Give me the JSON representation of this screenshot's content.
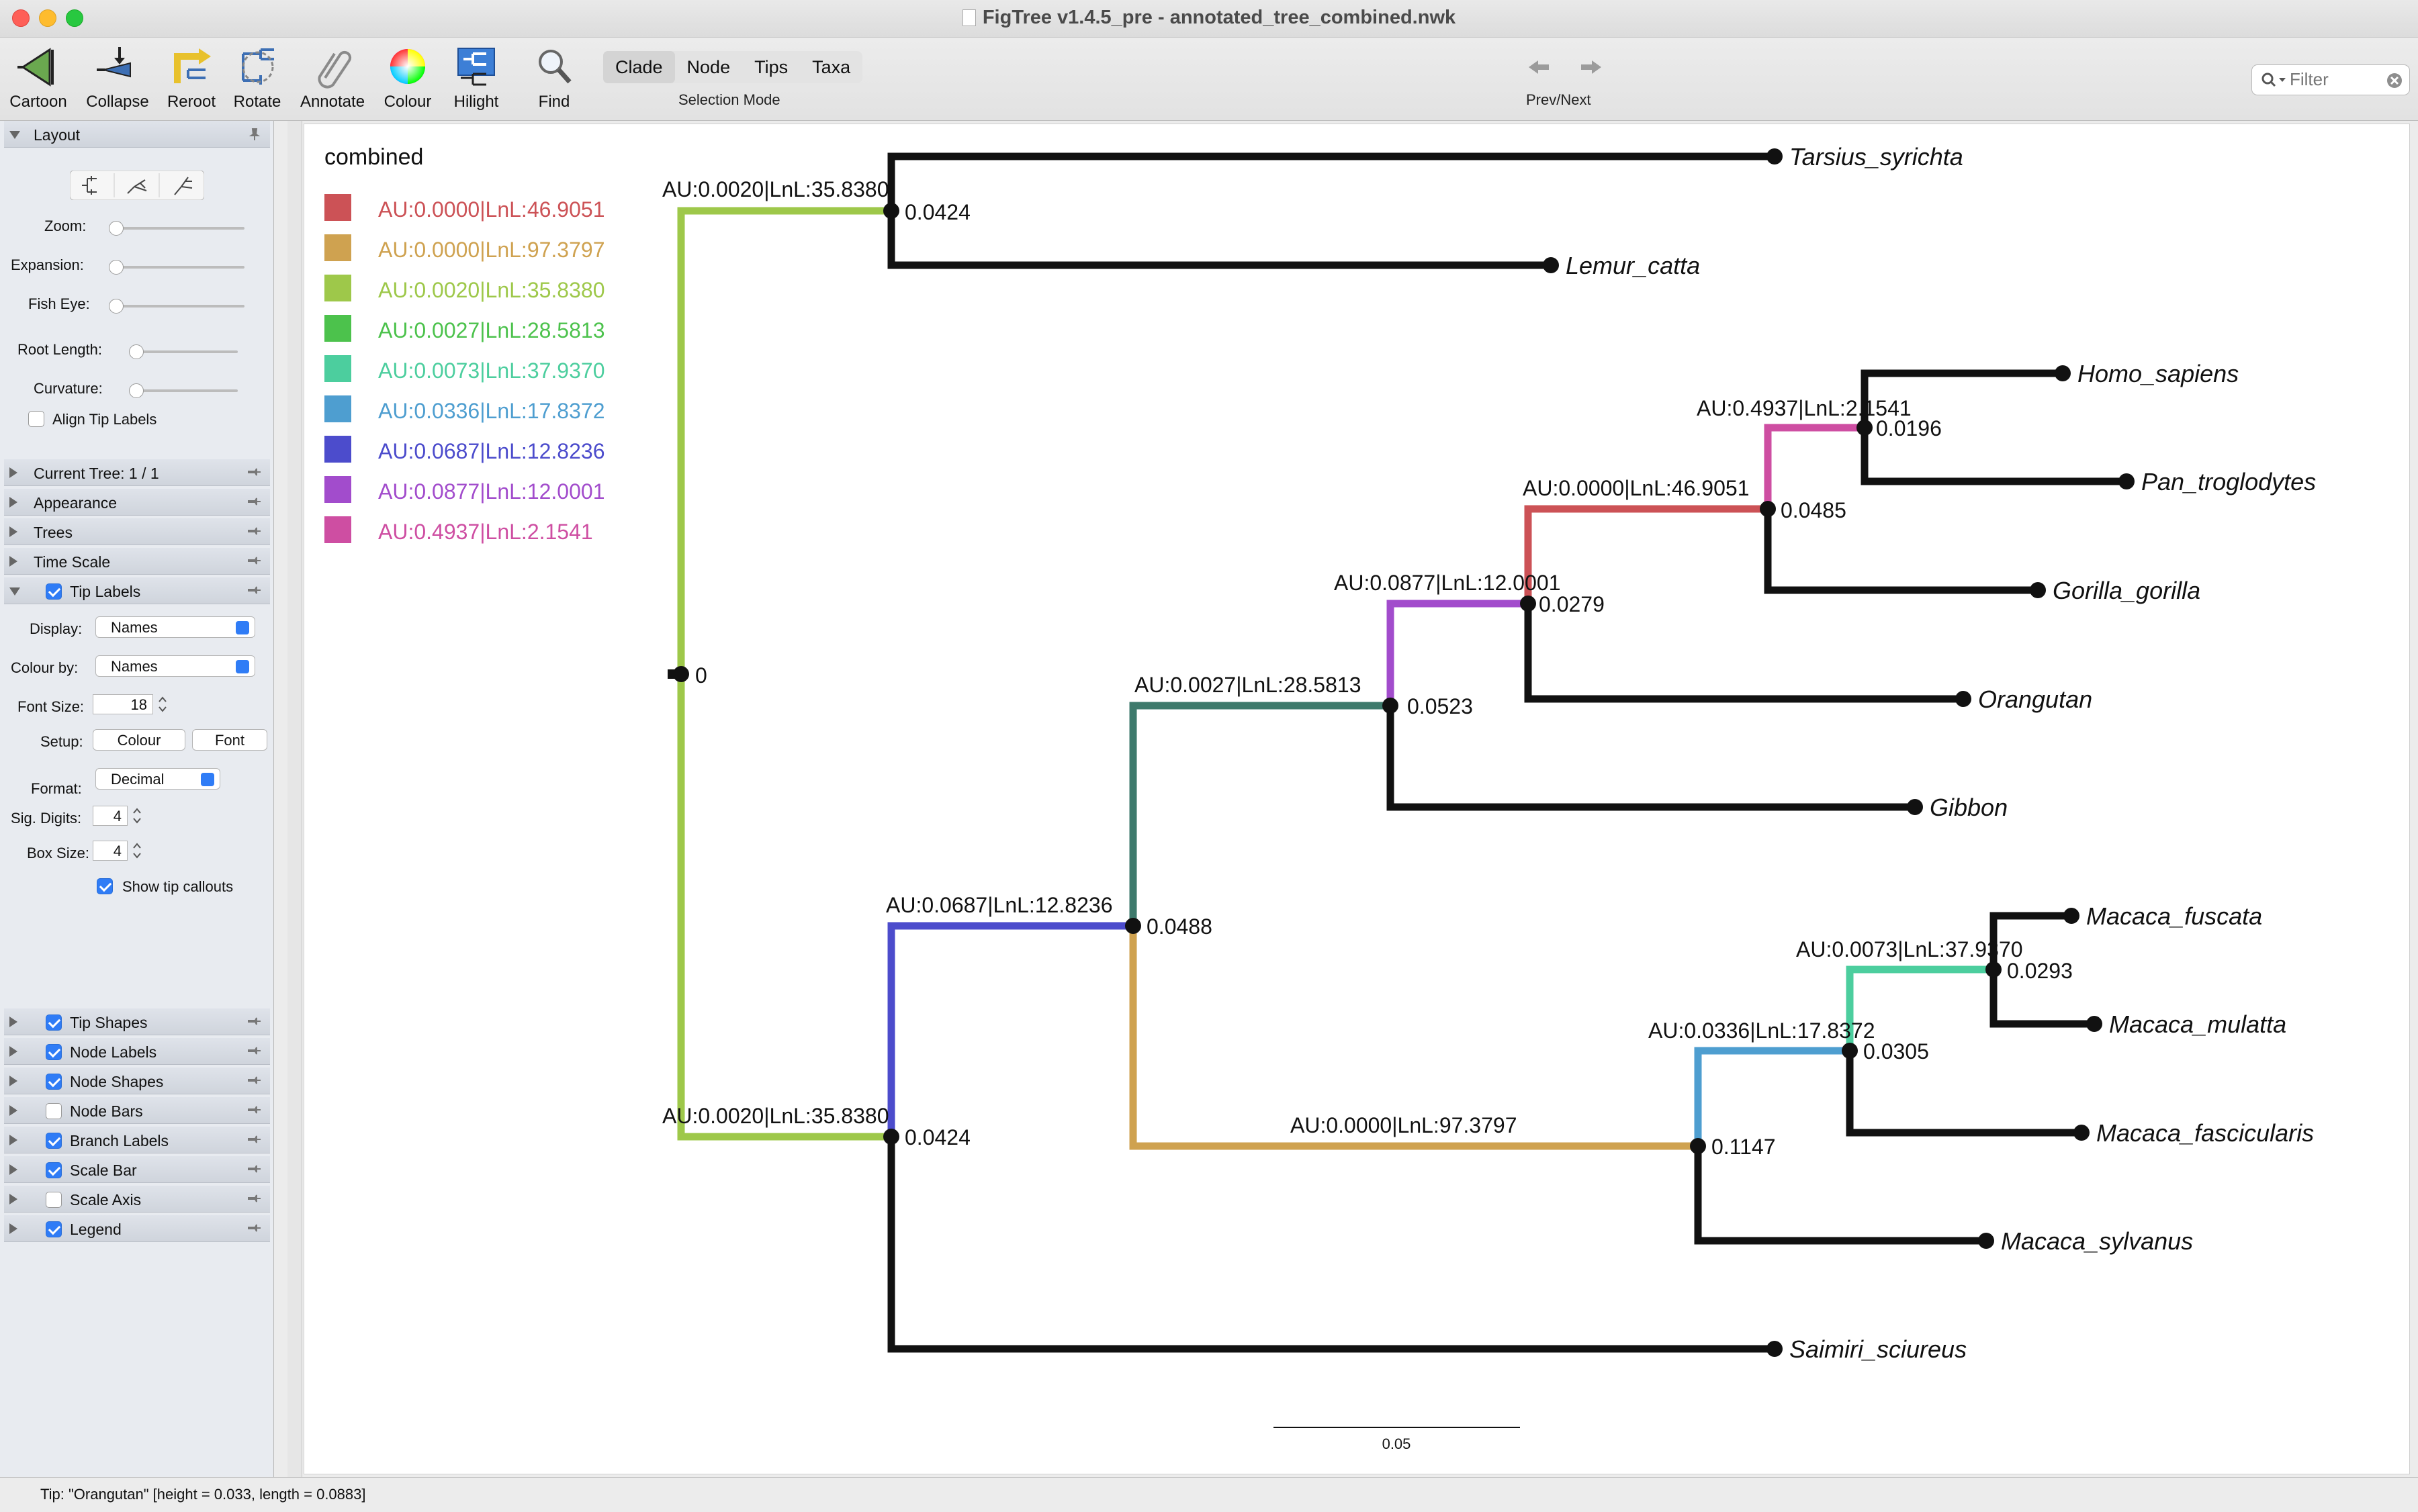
{
  "window": {
    "title": "FigTree v1.4.5_pre - annotated_tree_combined.nwk"
  },
  "toolbar": {
    "buttons": [
      {
        "label": "Cartoon",
        "icon": "cartoon-icon"
      },
      {
        "label": "Collapse",
        "icon": "collapse-icon"
      },
      {
        "label": "Reroot",
        "icon": "reroot-icon"
      },
      {
        "label": "Rotate",
        "icon": "rotate-icon"
      },
      {
        "label": "Annotate",
        "icon": "annotate-icon"
      },
      {
        "label": "Colour",
        "icon": "colour-wheel-icon"
      },
      {
        "label": "Hilight",
        "icon": "hilight-icon"
      },
      {
        "label": "Find",
        "icon": "find-icon"
      }
    ],
    "selection_modes": [
      "Clade",
      "Node",
      "Tips",
      "Taxa"
    ],
    "selected_mode": "Clade",
    "selection_caption": "Selection Mode",
    "prevnext_caption": "Prev/Next",
    "filter_placeholder": "Filter"
  },
  "sidebar": {
    "layout": {
      "title": "Layout",
      "zoom_label": "Zoom:",
      "expansion_label": "Expansion:",
      "fisheye_label": "Fish Eye:",
      "root_length_label": "Root Length:",
      "curvature_label": "Curvature:",
      "align_tip_labels": "Align Tip Labels"
    },
    "sections": [
      {
        "label": "Current Tree: 1 / 1",
        "checkbox": null
      },
      {
        "label": "Appearance",
        "checkbox": null
      },
      {
        "label": "Trees",
        "checkbox": null
      },
      {
        "label": "Time Scale",
        "checkbox": null
      }
    ],
    "tip_labels": {
      "title": "Tip Labels",
      "display_label": "Display:",
      "display_value": "Names",
      "colour_by_label": "Colour by:",
      "colour_by_value": "Names",
      "font_size_label": "Font Size:",
      "font_size_value": "18",
      "setup_label": "Setup:",
      "colour_button": "Colour",
      "font_button": "Font",
      "format_label": "Format:",
      "format_value": "Decimal",
      "sig_digits_label": "Sig. Digits:",
      "sig_digits_value": "4",
      "box_size_label": "Box Size:",
      "box_size_value": "4",
      "show_tip_callouts": "Show tip callouts"
    },
    "lower_sections": [
      {
        "label": "Tip Shapes",
        "checked": true
      },
      {
        "label": "Node Labels",
        "checked": true
      },
      {
        "label": "Node Shapes",
        "checked": true
      },
      {
        "label": "Node Bars",
        "checked": false
      },
      {
        "label": "Branch Labels",
        "checked": true
      },
      {
        "label": "Scale Bar",
        "checked": true
      },
      {
        "label": "Scale Axis",
        "checked": false
      },
      {
        "label": "Legend",
        "checked": true
      }
    ]
  },
  "legend": {
    "title": "combined",
    "items": [
      {
        "label": "AU:0.0000|LnL:46.9051",
        "color": "#cc5256"
      },
      {
        "label": "AU:0.0000|LnL:97.3797",
        "color": "#cfa250"
      },
      {
        "label": "AU:0.0020|LnL:35.8380",
        "color": "#9ec84a"
      },
      {
        "label": "AU:0.0027|LnL:28.5813",
        "color": "#4cc24c"
      },
      {
        "label": "AU:0.0073|LnL:37.9370",
        "color": "#4cce9e"
      },
      {
        "label": "AU:0.0336|LnL:17.8372",
        "color": "#4e9ed0"
      },
      {
        "label": "AU:0.0687|LnL:12.8236",
        "color": "#4c4ccc"
      },
      {
        "label": "AU:0.0877|LnL:12.0001",
        "color": "#a24ccc"
      },
      {
        "label": "AU:0.4937|LnL:2.1541",
        "color": "#ce4ea2"
      }
    ]
  },
  "tree": {
    "tips": [
      "Tarsius_syrichta",
      "Lemur_catta",
      "Homo_sapiens",
      "Pan_troglodytes",
      "Gorilla_gorilla",
      "Orangutan",
      "Gibbon",
      "Macaca_fuscata",
      "Macaca_mulatta",
      "Macaca_fascicularis",
      "Macaca_sylvanus",
      "Saimiri_sciureus"
    ],
    "node_labels": [
      "0",
      "0.0424",
      "0.0196",
      "0.0485",
      "0.0279",
      "0.0523",
      "0.0488",
      "0.0293",
      "0.0305",
      "0.1147",
      "0.0424"
    ],
    "branch_labels": [
      "AU:0.0020|LnL:35.8380",
      "AU:0.4937|LnL:2.1541",
      "AU:0.0000|LnL:46.9051",
      "AU:0.0877|LnL:12.0001",
      "AU:0.0027|LnL:28.5813",
      "AU:0.0687|LnL:12.8236",
      "AU:0.0073|LnL:37.9370",
      "AU:0.0336|LnL:17.8372",
      "AU:0.0000|LnL:97.3797",
      "AU:0.0020|LnL:35.8380"
    ],
    "scale_bar": "0.05"
  },
  "status": "Tip: \"Orangutan\" [height = 0.033, length = 0.0883]"
}
